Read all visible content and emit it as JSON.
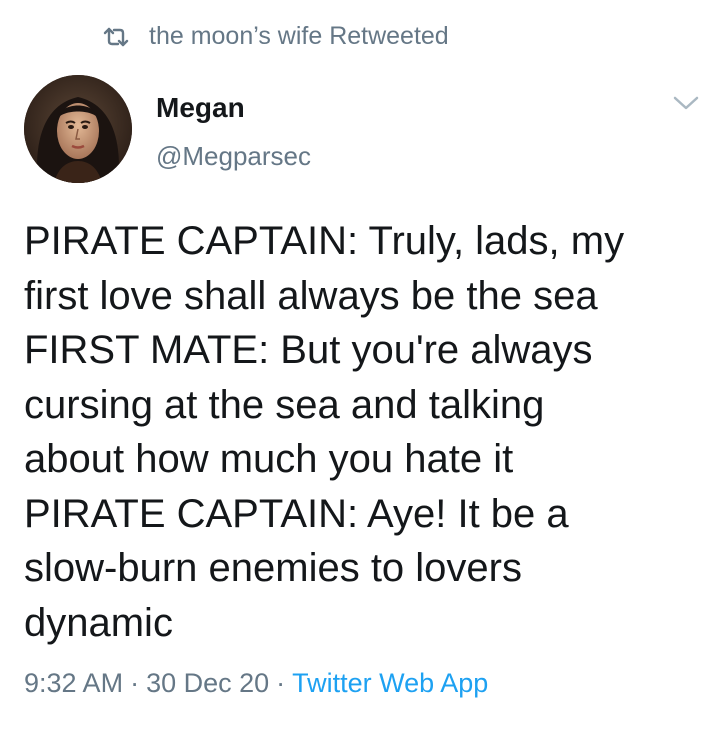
{
  "retweet": {
    "icon": "retweet-icon",
    "text": "the moon’s wife Retweeted"
  },
  "author": {
    "avatar": "avatar",
    "name": "Megan",
    "handle": "@Megparsec"
  },
  "menu": {
    "icon": "chevron-down-icon"
  },
  "tweet": {
    "text": "PIRATE CAPTAIN: Truly, lads, my\nfirst love shall always be the sea\nFIRST MATE: But you're always\ncursing at the sea and talking\nabout how much you hate it\nPIRATE CAPTAIN: Aye! It be a\nslow-burn enemies to lovers\ndynamic"
  },
  "meta": {
    "time": "9:32 AM",
    "separator": "·",
    "date": "30 Dec 20",
    "source": "Twitter Web App"
  },
  "colors": {
    "text_primary": "#14171a",
    "text_secondary": "#657786",
    "link": "#1da1f2",
    "background": "#ffffff"
  }
}
